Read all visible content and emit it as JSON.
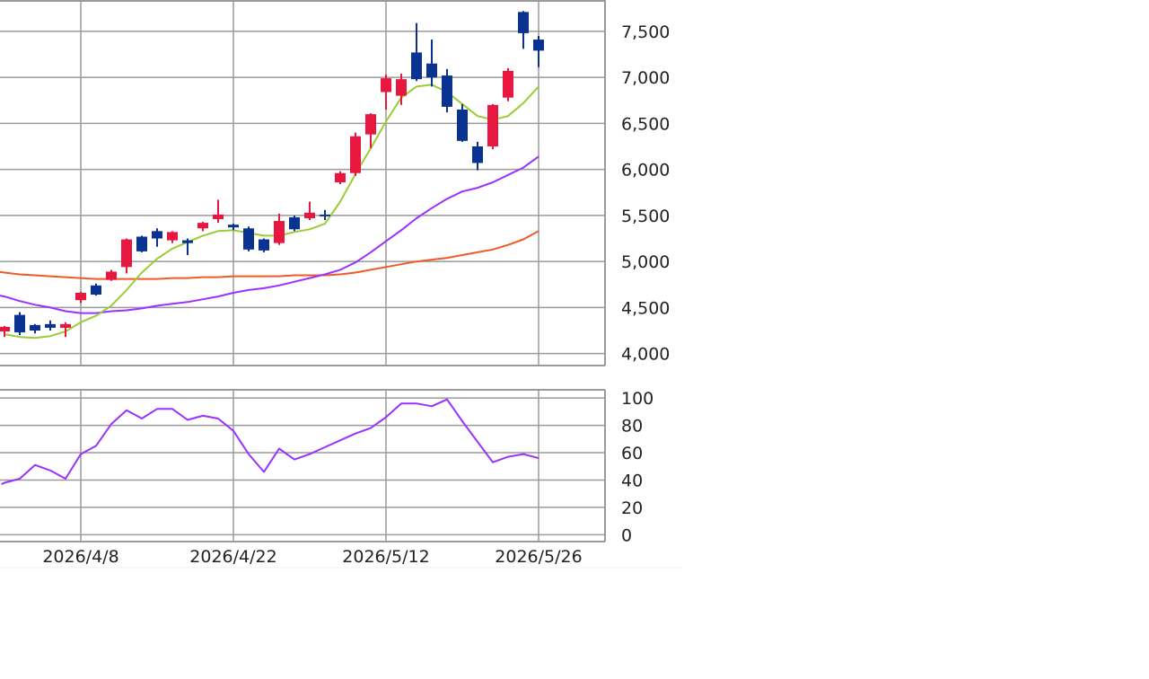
{
  "colors": {
    "up": "#e8173f",
    "down": "#0a3290",
    "ma_short": "#9acd32",
    "ma_mid": "#9b30ff",
    "ma_long": "#f05a28",
    "oscillator": "#9b30ff",
    "grid": "#9a9a9a"
  },
  "chart_data": [
    {
      "type": "candlestick",
      "panel": "price",
      "y_ticks": [
        4000,
        4500,
        5000,
        5500,
        6000,
        6500,
        7000,
        7500
      ],
      "y_tick_labels": [
        "4,000",
        "4,500",
        "5,000",
        "5,500",
        "6,000",
        "6,500",
        "7,000",
        "7,500"
      ],
      "ylim": [
        3870,
        7840
      ],
      "y_axis_position": "right",
      "grid": true,
      "x_tick_labels": [
        "2026/4/8",
        "2026/4/22",
        "2026/5/12",
        "2026/5/26"
      ],
      "x_tick_index": [
        5,
        15,
        25,
        35
      ],
      "candles": [
        {
          "open": 4240,
          "close": 4290,
          "high": 4300,
          "low": 4180
        },
        {
          "open": 4420,
          "close": 4230,
          "high": 4450,
          "low": 4200
        },
        {
          "open": 4310,
          "close": 4250,
          "high": 4320,
          "low": 4220
        },
        {
          "open": 4320,
          "close": 4280,
          "high": 4360,
          "low": 4250
        },
        {
          "open": 4280,
          "close": 4320,
          "high": 4340,
          "low": 4180
        },
        {
          "open": 4580,
          "close": 4660,
          "high": 4670,
          "low": 4550
        },
        {
          "open": 4740,
          "close": 4640,
          "high": 4760,
          "low": 4630
        },
        {
          "open": 4800,
          "close": 4890,
          "high": 4910,
          "low": 4790
        },
        {
          "open": 4940,
          "close": 5240,
          "high": 5250,
          "low": 4870
        },
        {
          "open": 5270,
          "close": 5110,
          "high": 5280,
          "low": 5100
        },
        {
          "open": 5330,
          "close": 5250,
          "high": 5360,
          "low": 5160
        },
        {
          "open": 5230,
          "close": 5320,
          "high": 5330,
          "low": 5200
        },
        {
          "open": 5230,
          "close": 5200,
          "high": 5250,
          "low": 5070
        },
        {
          "open": 5360,
          "close": 5420,
          "high": 5430,
          "low": 5330
        },
        {
          "open": 5460,
          "close": 5510,
          "high": 5670,
          "low": 5420
        },
        {
          "open": 5400,
          "close": 5370,
          "high": 5410,
          "low": 5340
        },
        {
          "open": 5360,
          "close": 5130,
          "high": 5380,
          "low": 5110
        },
        {
          "open": 5240,
          "close": 5120,
          "high": 5250,
          "low": 5100
        },
        {
          "open": 5200,
          "close": 5440,
          "high": 5520,
          "low": 5180
        },
        {
          "open": 5480,
          "close": 5350,
          "high": 5500,
          "low": 5330
        },
        {
          "open": 5470,
          "close": 5530,
          "high": 5650,
          "low": 5450
        },
        {
          "open": 5510,
          "close": 5500,
          "high": 5560,
          "low": 5450
        },
        {
          "open": 5860,
          "close": 5960,
          "high": 5980,
          "low": 5840
        },
        {
          "open": 5960,
          "close": 6360,
          "high": 6400,
          "low": 5930
        },
        {
          "open": 6380,
          "close": 6600,
          "high": 6610,
          "low": 6230
        },
        {
          "open": 6840,
          "close": 6990,
          "high": 7030,
          "low": 6650
        },
        {
          "open": 6800,
          "close": 6980,
          "high": 7040,
          "low": 6700
        },
        {
          "open": 7270,
          "close": 6980,
          "high": 7590,
          "low": 6960
        },
        {
          "open": 7150,
          "close": 7000,
          "high": 7410,
          "low": 6900
        },
        {
          "open": 7020,
          "close": 6680,
          "high": 7090,
          "low": 6620
        },
        {
          "open": 6650,
          "close": 6310,
          "high": 6710,
          "low": 6300
        },
        {
          "open": 6250,
          "close": 6070,
          "high": 6300,
          "low": 5990
        },
        {
          "open": 6250,
          "close": 6700,
          "high": 6710,
          "low": 6220
        },
        {
          "open": 6780,
          "close": 7070,
          "high": 7100,
          "low": 6740
        },
        {
          "open": 7710,
          "close": 7480,
          "high": 7720,
          "low": 7310
        },
        {
          "open": 7410,
          "close": 7290,
          "high": 7450,
          "low": 7110
        }
      ],
      "ma_short": {
        "x": [
          0,
          1,
          2,
          3,
          4,
          5,
          6,
          7,
          8,
          9,
          10,
          11,
          12,
          13,
          14,
          15,
          16,
          17,
          18,
          19,
          20,
          21,
          22,
          23,
          24,
          25,
          26,
          27,
          28,
          29,
          30,
          31,
          32,
          33,
          34,
          35
        ],
        "values": [
          4210,
          4180,
          4170,
          4190,
          4240,
          4340,
          4410,
          4520,
          4690,
          4880,
          5030,
          5140,
          5210,
          5280,
          5330,
          5340,
          5310,
          5280,
          5280,
          5320,
          5350,
          5410,
          5650,
          5950,
          6230,
          6520,
          6780,
          6900,
          6920,
          6840,
          6710,
          6580,
          6540,
          6580,
          6720,
          6900
        ]
      },
      "ma_mid": {
        "x": [
          -1,
          0,
          1,
          2,
          3,
          4,
          5,
          6,
          7,
          8,
          9,
          10,
          11,
          12,
          13,
          14,
          15,
          16,
          17,
          18,
          19,
          20,
          21,
          22,
          23,
          24,
          25,
          26,
          27,
          28,
          29,
          30,
          31,
          32,
          33,
          34,
          35
        ],
        "values": [
          4650,
          4620,
          4570,
          4530,
          4500,
          4460,
          4440,
          4440,
          4460,
          4470,
          4490,
          4520,
          4540,
          4560,
          4590,
          4620,
          4660,
          4690,
          4710,
          4740,
          4780,
          4820,
          4860,
          4910,
          4990,
          5100,
          5220,
          5340,
          5470,
          5580,
          5680,
          5760,
          5800,
          5860,
          5940,
          6020,
          6140
        ]
      },
      "ma_long": {
        "x": [
          -1,
          0,
          1,
          2,
          3,
          4,
          5,
          6,
          7,
          8,
          9,
          10,
          11,
          12,
          13,
          14,
          15,
          16,
          17,
          18,
          19,
          20,
          21,
          22,
          23,
          24,
          25,
          26,
          27,
          28,
          29,
          30,
          31,
          32,
          33,
          34,
          35
        ],
        "values": [
          4900,
          4880,
          4860,
          4850,
          4840,
          4830,
          4820,
          4810,
          4810,
          4810,
          4810,
          4810,
          4820,
          4820,
          4830,
          4830,
          4840,
          4840,
          4840,
          4840,
          4850,
          4850,
          4850,
          4860,
          4880,
          4910,
          4940,
          4970,
          5000,
          5020,
          5040,
          5070,
          5100,
          5130,
          5180,
          5240,
          5330
        ]
      }
    },
    {
      "type": "line",
      "panel": "oscillator",
      "y_ticks": [
        0,
        20,
        40,
        60,
        80,
        100
      ],
      "y_tick_labels": [
        "0",
        "20",
        "40",
        "60",
        "80",
        "100"
      ],
      "ylim": [
        -5,
        106
      ],
      "y_axis_position": "right",
      "grid": true,
      "x_tick_labels": [
        "2026/4/8",
        "2026/4/22",
        "2026/5/12",
        "2026/5/26"
      ],
      "x_tick_index": [
        5,
        15,
        25,
        35
      ],
      "x": [
        -0.2,
        0,
        1,
        2,
        3,
        4,
        5,
        6,
        7,
        8,
        9,
        10,
        11,
        12,
        13,
        14,
        15,
        16,
        17,
        18,
        19,
        20,
        21,
        22,
        23,
        24,
        25,
        26,
        27,
        28,
        29,
        30,
        31,
        32,
        33,
        34,
        35
      ],
      "values": [
        37,
        38,
        41,
        51,
        47,
        41,
        59,
        65,
        81,
        91,
        85,
        92,
        92,
        84,
        87,
        85,
        76,
        59,
        46,
        63,
        55,
        59,
        64,
        69,
        74,
        78,
        86,
        96,
        96,
        94,
        99,
        83,
        68,
        53,
        57,
        59,
        56
      ]
    }
  ]
}
